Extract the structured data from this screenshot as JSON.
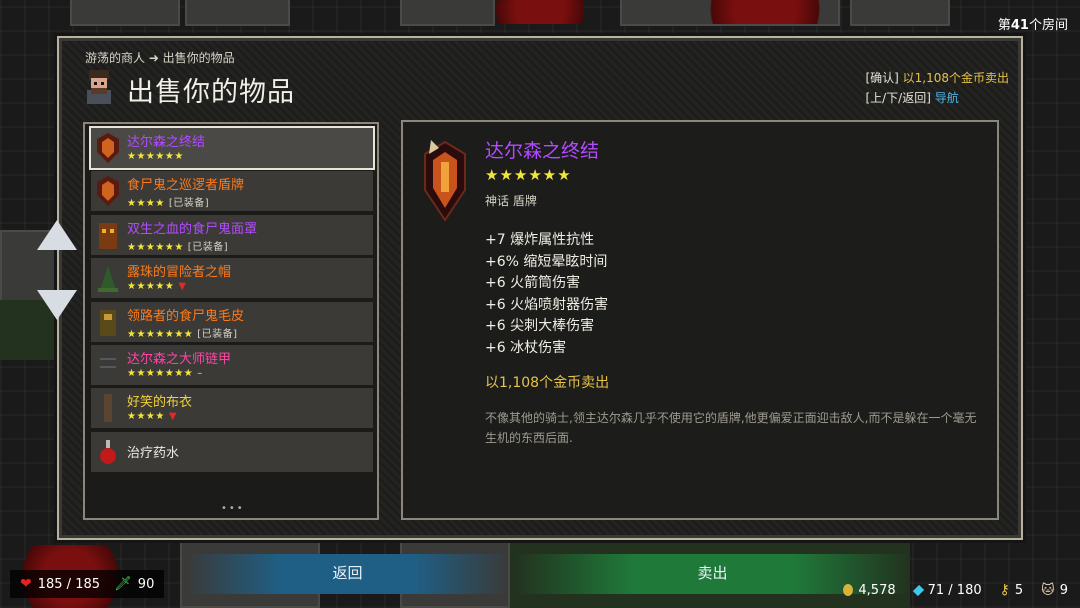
{
  "room": {
    "prefix": "第",
    "number": "41",
    "suffix": "个房间"
  },
  "header": {
    "breadcrumb": "游荡的商人 ➜ 出售你的物品",
    "title": "出售你的物品",
    "hint_confirm_key": "[确认]",
    "hint_confirm_text": "以1,108个金币卖出",
    "hint_nav_key": "[上/下/返回]",
    "hint_nav_text": "导航"
  },
  "items": [
    {
      "name": "达尔森之终结",
      "stars": "★★★★★★",
      "tag": "",
      "mark": "",
      "color": "#b24bff",
      "icon": "shield-icon",
      "selected": true
    },
    {
      "name": "食尸鬼之巡逻者盾牌",
      "stars": "★★★★",
      "tag": "[已装备]",
      "mark": "",
      "color": "#ff7a1a",
      "icon": "shield-icon"
    },
    {
      "name": "双生之血的食尸鬼面罩",
      "stars": "★★★★★★",
      "tag": "[已装备]",
      "mark": "",
      "color": "#b24bff",
      "icon": "mask-icon"
    },
    {
      "name": "露珠的冒险者之帽",
      "stars": "★★★★★",
      "tag": "",
      "mark": "▼",
      "color": "#ff7a1a",
      "icon": "hat-icon"
    },
    {
      "name": "领路者的食尸鬼毛皮",
      "stars": "★★★★★★★",
      "tag": "[已装备]",
      "mark": "",
      "color": "#ff7a1a",
      "icon": "armor-icon"
    },
    {
      "name": "达尔森之大师链甲",
      "stars": "★★★★★★★",
      "tag": "",
      "mark": "–",
      "color": "#ff44a8",
      "icon": "chainmail-icon"
    },
    {
      "name": "好笑的布衣",
      "stars": "★★★★",
      "tag": "",
      "mark": "▼",
      "color": "#f2d23a",
      "icon": "cloth-icon"
    },
    {
      "name": "治疗药水",
      "stars": "",
      "tag": "",
      "mark": "",
      "color": "#ecebe6",
      "icon": "potion-icon"
    }
  ],
  "page_dots": "•••",
  "detail": {
    "name": "达尔森之终结",
    "stars": "★★★★★★",
    "type": "神话 盾牌",
    "stats": [
      "+7 爆炸属性抗性",
      "+6% 缩短晕眩时间",
      "+6 火箭筒伤害",
      "+6 火焰喷射器伤害",
      "+6 尖刺大棒伤害",
      "+6 冰杖伤害"
    ],
    "price": "以1,108个金币卖出",
    "description": "不像其他的骑士,领主达尔森几乎不使用它的盾牌,他更偏爱正面迎击敌人,而不是躲在一个毫无生机的东西后面."
  },
  "buttons": {
    "back": "返回",
    "sell": "卖出"
  },
  "hud": {
    "hp": "185 / 185",
    "attack": "90",
    "gold": "4,578",
    "gems": "71 / 180",
    "keys": "5",
    "pets": "9"
  },
  "colors": {
    "mythic": "#b24bff",
    "set": "#ff44a8",
    "legendary": "#ff7a1a",
    "gold": "#e6c24a",
    "nav": "#4fb6ea"
  }
}
